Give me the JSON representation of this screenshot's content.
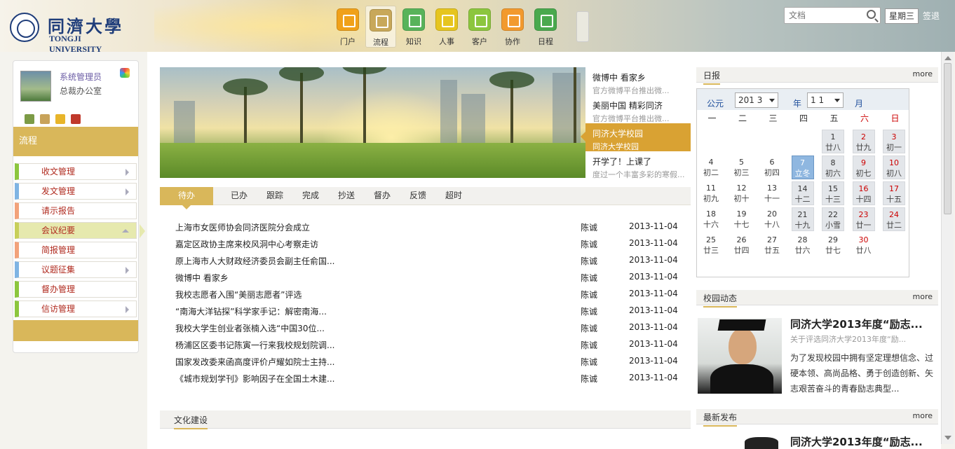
{
  "header": {
    "logo_cn": "同濟大學",
    "logo_en": "TONGJI UNIVERSITY",
    "nav": [
      {
        "label": "门户",
        "color": "#f0a11a"
      },
      {
        "label": "流程",
        "color": "#c8a85a"
      },
      {
        "label": "知识",
        "color": "#58b35a"
      },
      {
        "label": "人事",
        "color": "#e6c51f"
      },
      {
        "label": "客户",
        "color": "#8cc63e"
      },
      {
        "label": "协作",
        "color": "#f29a2e"
      },
      {
        "label": "日程",
        "color": "#4aa94e"
      }
    ],
    "search_placeholder": "文档",
    "weekday": "星期三",
    "signin": "签退"
  },
  "sidebar": {
    "user_name": "系统管理员",
    "user_dept": "总裁办公室",
    "section_title": "流程",
    "menu": [
      {
        "label": "收文管理",
        "color": "#8cc63e"
      },
      {
        "label": "发文管理",
        "color": "#7fb4e3"
      },
      {
        "label": "请示报告",
        "color": "#f2a27b"
      },
      {
        "label": "会议纪要",
        "color": "#c7cf5a"
      },
      {
        "label": "简报管理",
        "color": "#f2a27b"
      },
      {
        "label": "议题征集",
        "color": "#7fb4e3"
      },
      {
        "label": "督办管理",
        "color": "#8cc63e"
      },
      {
        "label": "信访管理",
        "color": "#8cc63e"
      }
    ]
  },
  "banner_news": [
    {
      "title": "微博中 看家乡",
      "sub": "官方微博平台推出微..."
    },
    {
      "title": "美丽中国 精彩同济",
      "sub": "官方微博平台推出微..."
    },
    {
      "title": "同济大学校园",
      "sub": "同济大学校园"
    },
    {
      "title": "开学了！上课了",
      "sub": "度过一个丰富多彩的寒假..."
    }
  ],
  "tabs": [
    "待办",
    "已办",
    "跟踪",
    "完成",
    "抄送",
    "督办",
    "反馈",
    "超时"
  ],
  "docs": [
    {
      "title": "上海市女医师协会同济医院分会成立",
      "author": "陈诚",
      "date": "2013-11-04"
    },
    {
      "title": "嘉定区政协主席来校风洞中心考察走访",
      "author": "陈诚",
      "date": "2013-11-04"
    },
    {
      "title": "原上海市人大财政经济委员会副主任俞国...",
      "author": "陈诚",
      "date": "2013-11-04"
    },
    {
      "title": "微博中 看家乡",
      "author": "陈诚",
      "date": "2013-11-04"
    },
    {
      "title": "我校志愿者入围“美丽志愿者”评选",
      "author": "陈诚",
      "date": "2013-11-04"
    },
    {
      "title": "“南海大洋钻探”科学家手记：解密南海...",
      "author": "陈诚",
      "date": "2013-11-04"
    },
    {
      "title": "我校大学生创业者张楠入选“中国30位...",
      "author": "陈诚",
      "date": "2013-11-04"
    },
    {
      "title": "杨浦区区委书记陈寅一行来我校规划院调...",
      "author": "陈诚",
      "date": "2013-11-04"
    },
    {
      "title": "国家发改委来函高度评价卢耀如院士主持...",
      "author": "陈诚",
      "date": "2013-11-04"
    },
    {
      "title": "《城市规划学刊》影响因子在全国土木建...",
      "author": "陈诚",
      "date": "2013-11-04"
    }
  ],
  "culture_title": "文化建设",
  "calendar": {
    "panel_title": "日报",
    "more": "more",
    "era_label": "公元",
    "year_value": "201 3",
    "year_label": "年",
    "month_value": "1 1",
    "month_label": "月",
    "weekdays": [
      "一",
      "二",
      "三",
      "四",
      "五",
      "六",
      "日"
    ],
    "weeks": [
      [
        null,
        null,
        null,
        null,
        {
          "d": "1",
          "l": "廿八"
        },
        {
          "d": "2",
          "l": "廿九"
        },
        {
          "d": "3",
          "l": "初一"
        }
      ],
      [
        {
          "d": "4",
          "l": "初二"
        },
        {
          "d": "5",
          "l": "初三"
        },
        {
          "d": "6",
          "l": "初四"
        },
        {
          "d": "7",
          "l": "立冬"
        },
        {
          "d": "8",
          "l": "初六"
        },
        {
          "d": "9",
          "l": "初七"
        },
        {
          "d": "10",
          "l": "初八"
        }
      ],
      [
        {
          "d": "11",
          "l": "初九"
        },
        {
          "d": "12",
          "l": "初十"
        },
        {
          "d": "13",
          "l": "十一"
        },
        {
          "d": "14",
          "l": "十二"
        },
        {
          "d": "15",
          "l": "十三"
        },
        {
          "d": "16",
          "l": "十四"
        },
        {
          "d": "17",
          "l": "十五"
        }
      ],
      [
        {
          "d": "18",
          "l": "十六"
        },
        {
          "d": "19",
          "l": "十七"
        },
        {
          "d": "20",
          "l": "十八"
        },
        {
          "d": "21",
          "l": "十九"
        },
        {
          "d": "22",
          "l": "小雪"
        },
        {
          "d": "23",
          "l": "廿一"
        },
        {
          "d": "24",
          "l": "廿二"
        }
      ],
      [
        {
          "d": "25",
          "l": "廿三"
        },
        {
          "d": "26",
          "l": "廿四"
        },
        {
          "d": "27",
          "l": "廿五"
        },
        {
          "d": "28",
          "l": "廿六"
        },
        {
          "d": "29",
          "l": "廿七"
        },
        {
          "d": "30",
          "l": "廿八"
        },
        null
      ]
    ],
    "today": "7"
  },
  "campus": {
    "panel_title": "校园动态",
    "more": "more",
    "title": "同济大学2013年度“励志...",
    "sub": "关于评选同济大学2013年度“励...",
    "body": "为了发现校园中拥有坚定理想信念、过硬本领、高尚品格、勇于创造创新、矢志艰苦奋斗的青春励志典型..."
  },
  "latest": {
    "panel_title": "最新发布",
    "more": "more",
    "title": "同济大学2013年度“励志..."
  }
}
